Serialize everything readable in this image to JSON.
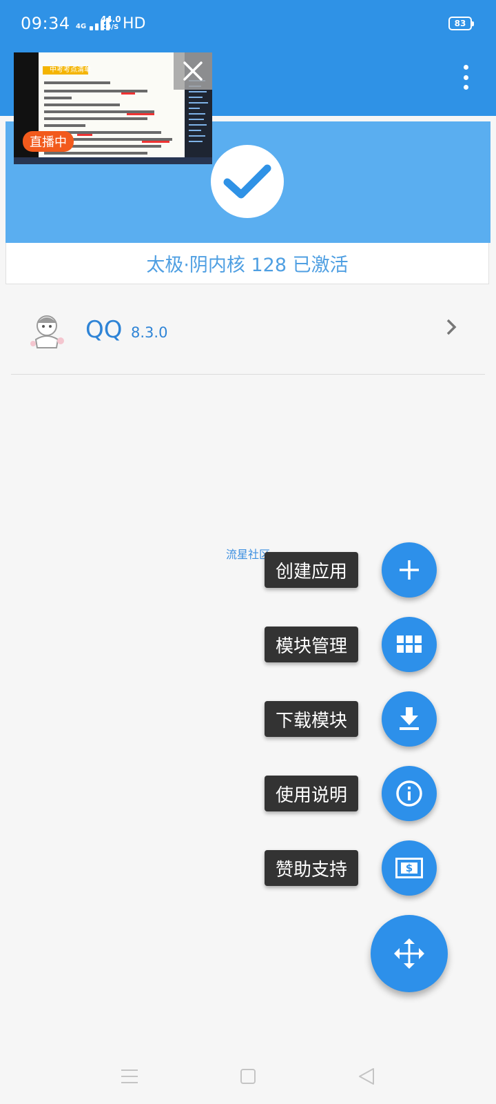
{
  "status_bar": {
    "time": "09:34",
    "network_type": "4G",
    "speed_value": "44.0",
    "speed_unit": "KB/S",
    "hd": "HD",
    "battery": "83"
  },
  "live_overlay": {
    "badge": "直播中",
    "slide_heading": "中考考点清单",
    "close_icon": "close-icon"
  },
  "activation": {
    "icon": "check-icon",
    "text": "太极·阴内核 128 已激活"
  },
  "app_list": [
    {
      "name": "QQ",
      "version": "8.3.0",
      "icon": "app-avatar-icon"
    }
  ],
  "watermark": "流星社区",
  "fab_menu": [
    {
      "label": "创建应用",
      "icon": "plus-icon"
    },
    {
      "label": "模块管理",
      "icon": "grid-icon"
    },
    {
      "label": "下载模块",
      "icon": "download-icon"
    },
    {
      "label": "使用说明",
      "icon": "info-icon"
    },
    {
      "label": "赞助支持",
      "icon": "money-icon"
    }
  ],
  "fab_main_icon": "move-arrows-icon",
  "colors": {
    "primary": "#2f92e6",
    "hero": "#5aaef0",
    "accent_text": "#4f9fe2",
    "fab": "#2d90ea",
    "live_badge": "#f25a1c"
  }
}
